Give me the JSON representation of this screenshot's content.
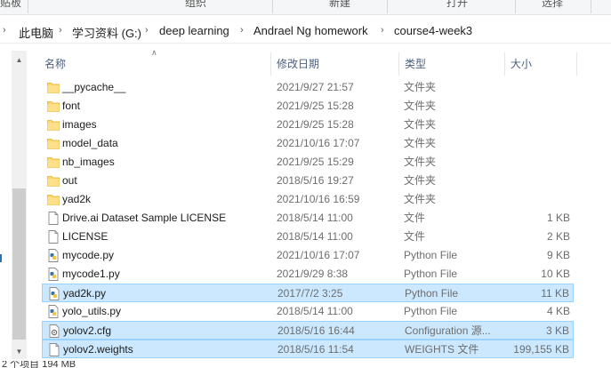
{
  "ribbon": {
    "groups": [
      "贴板",
      "组织",
      "新建",
      "打开",
      "选择"
    ]
  },
  "breadcrumb": {
    "items": [
      "此电脑",
      "学习资料 (G:)",
      "deep learning",
      "Andrael Ng homework",
      "course4-week3"
    ]
  },
  "columns": {
    "name": "名称",
    "date": "修改日期",
    "type": "类型",
    "size": "大小"
  },
  "files": [
    {
      "name": "__pycache__",
      "date": "2021/9/27 21:57",
      "type": "文件夹",
      "size": "",
      "icon": "folder-icon"
    },
    {
      "name": "font",
      "date": "2021/9/25 15:28",
      "type": "文件夹",
      "size": "",
      "icon": "folder-icon"
    },
    {
      "name": "images",
      "date": "2021/9/25 15:28",
      "type": "文件夹",
      "size": "",
      "icon": "folder-icon"
    },
    {
      "name": "model_data",
      "date": "2021/10/16 17:07",
      "type": "文件夹",
      "size": "",
      "icon": "folder-icon"
    },
    {
      "name": "nb_images",
      "date": "2021/9/25 15:29",
      "type": "文件夹",
      "size": "",
      "icon": "folder-icon"
    },
    {
      "name": "out",
      "date": "2018/5/16 19:27",
      "type": "文件夹",
      "size": "",
      "icon": "folder-icon"
    },
    {
      "name": "yad2k",
      "date": "2021/10/16 16:59",
      "type": "文件夹",
      "size": "",
      "icon": "folder-icon"
    },
    {
      "name": "Drive.ai Dataset Sample LICENSE",
      "date": "2018/5/14 11:00",
      "type": "文件",
      "size": "1 KB",
      "icon": "file-icon"
    },
    {
      "name": "LICENSE",
      "date": "2018/5/14 11:00",
      "type": "文件",
      "size": "2 KB",
      "icon": "file-icon"
    },
    {
      "name": "mycode.py",
      "date": "2021/10/16 17:07",
      "type": "Python File",
      "size": "9 KB",
      "icon": "python-file-icon"
    },
    {
      "name": "mycode1.py",
      "date": "2021/9/29 8:38",
      "type": "Python File",
      "size": "10 KB",
      "icon": "python-file-icon"
    },
    {
      "name": "yad2k.py",
      "date": "2017/7/2 3:25",
      "type": "Python File",
      "size": "11 KB",
      "icon": "python-file-icon",
      "selected": true
    },
    {
      "name": "yolo_utils.py",
      "date": "2018/5/14 11:00",
      "type": "Python File",
      "size": "4 KB",
      "icon": "python-file-icon"
    },
    {
      "name": "yolov2.cfg",
      "date": "2018/5/16 16:44",
      "type": "Configuration 源...",
      "size": "3 KB",
      "icon": "config-file-icon",
      "selected": true
    },
    {
      "name": "yolov2.weights",
      "date": "2018/5/16 11:54",
      "type": "WEIGHTS 文件",
      "size": "199,155 KB",
      "icon": "file-icon",
      "selected": true
    }
  ],
  "status": {
    "text": "2 个项目  194 MB"
  },
  "colors": {
    "selected_bg": "#cce8ff",
    "selected_border": "#99d1ff",
    "folder": "#ffd766"
  }
}
